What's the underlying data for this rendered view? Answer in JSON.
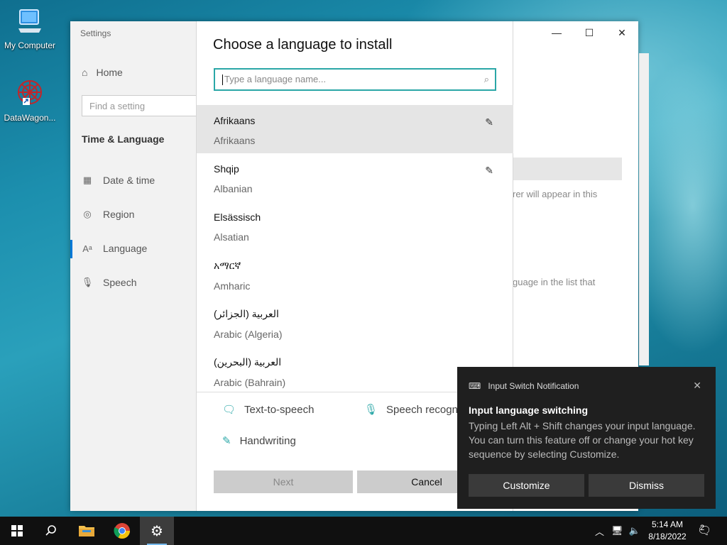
{
  "desktop": {
    "icons": [
      {
        "label": "My Computer"
      },
      {
        "label": "DataWagon..."
      }
    ]
  },
  "settings": {
    "window_title": "Settings",
    "home_label": "Home",
    "search_placeholder": "Find a setting",
    "section_title": "Time & Language",
    "nav_items": [
      {
        "label": "Date & time",
        "icon": "calendar-clock-icon"
      },
      {
        "label": "Region",
        "icon": "globe-icon"
      },
      {
        "label": "Language",
        "icon": "language-icon"
      },
      {
        "label": "Speech",
        "icon": "microphone-icon"
      }
    ],
    "bg_text_1": "rer will appear in this",
    "bg_text_2": "guage in the list that"
  },
  "dialog": {
    "title": "Choose a language to install",
    "search_placeholder": "Type a language name...",
    "languages": [
      {
        "native": "Afrikaans",
        "english": "Afrikaans",
        "selected": true,
        "has_flag": true
      },
      {
        "native": "Shqip",
        "english": "Albanian",
        "has_flag": true
      },
      {
        "native": "Elsässisch",
        "english": "Alsatian"
      },
      {
        "native": "አማርኛ",
        "english": "Amharic"
      },
      {
        "native": "العربية (الجزائر)",
        "english": "Arabic (Algeria)"
      },
      {
        "native": "العربية (البحرين)",
        "english": "Arabic (Bahrain)"
      }
    ],
    "features": {
      "tts": "Text-to-speech",
      "speech": "Speech recogn",
      "handwriting": "Handwriting"
    },
    "next_label": "Next",
    "cancel_label": "Cancel"
  },
  "notification": {
    "app_name": "Input Switch Notification",
    "title": "Input language switching",
    "body": "Typing Left Alt + Shift changes your input language. You can turn this feature off or change your hot key sequence by selecting Customize.",
    "customize_label": "Customize",
    "dismiss_label": "Dismiss"
  },
  "taskbar": {
    "time": "5:14 AM",
    "date": "8/18/2022",
    "notification_count": "2"
  },
  "colors": {
    "accent": "#2aa7a7",
    "taskbar": "#101010",
    "notification_bg": "#1f1f1f"
  }
}
